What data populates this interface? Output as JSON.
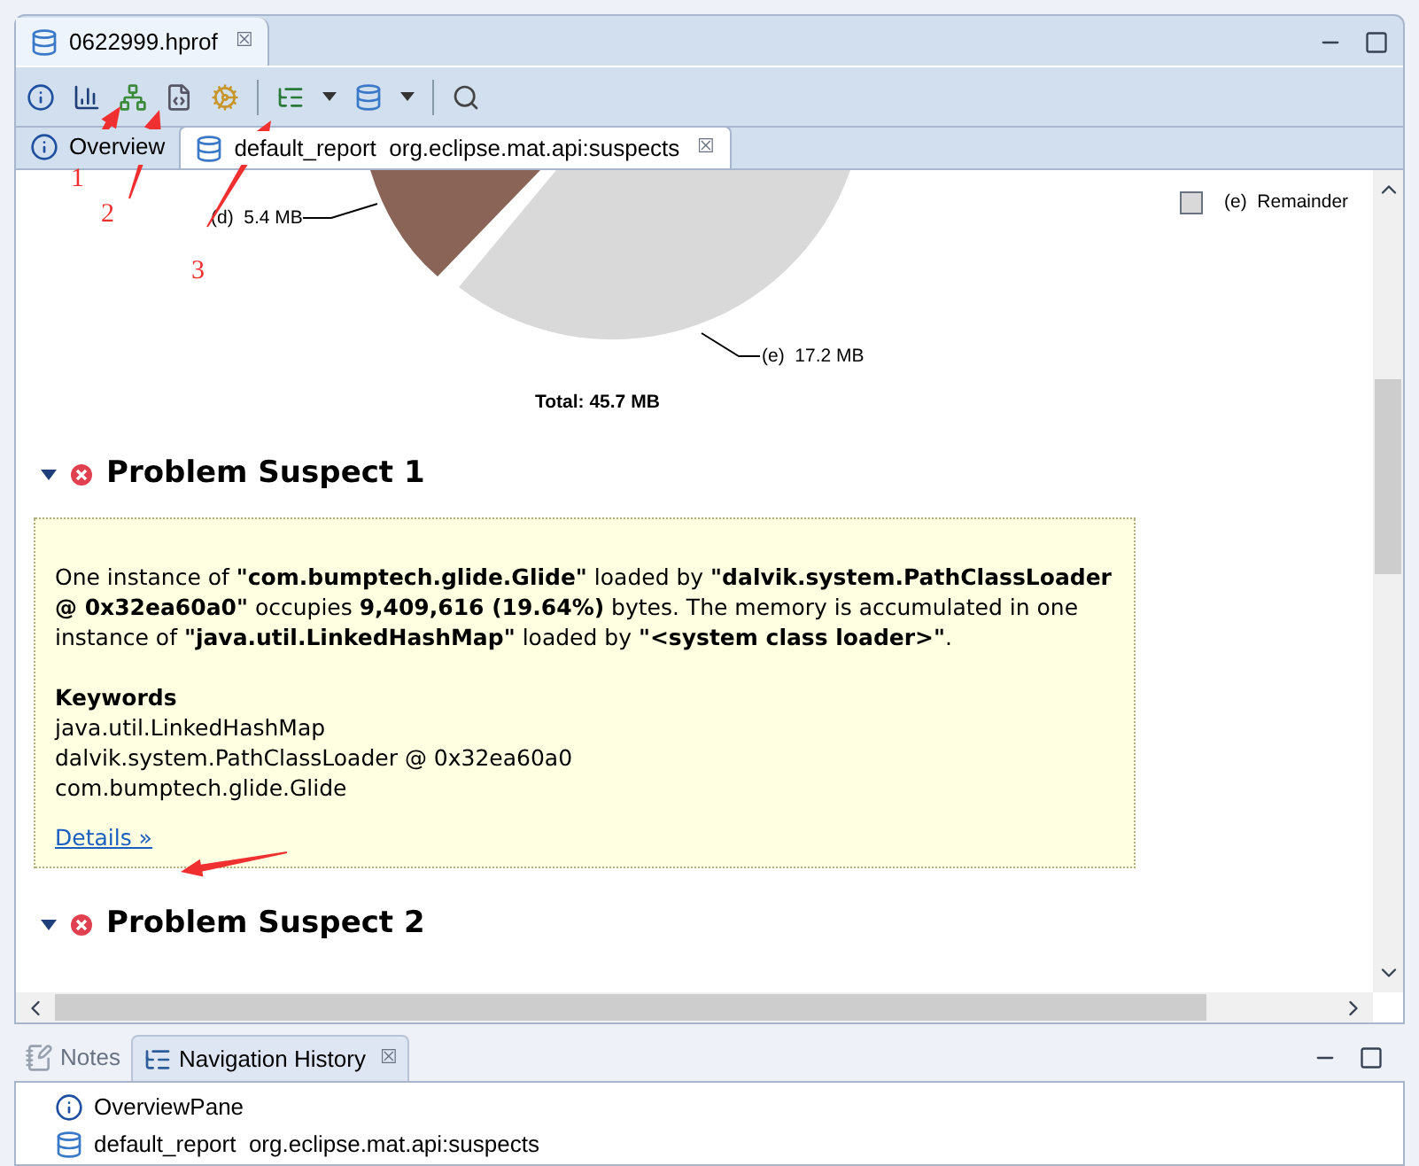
{
  "editor_tab": {
    "title": "0622999.hprof",
    "close": "☒"
  },
  "inner_tabs": [
    {
      "label": "Overview",
      "selected": false,
      "kind": "info"
    },
    {
      "label": "default_report  org.eclipse.mat.api:suspects",
      "selected": true,
      "kind": "report",
      "close": "☒"
    }
  ],
  "chart": {
    "labels": [
      {
        "text": "(d)  5.4 MB",
        "kind": "left"
      },
      {
        "text": "(e)  17.2 MB",
        "kind": "right"
      }
    ],
    "total": "Total: 45.7 MB",
    "legend": [
      {
        "label": "(e)  Remainder",
        "color": "#d9d9d9"
      }
    ]
  },
  "suspects": [
    {
      "title": "Problem Suspect 1",
      "description": "One instance of **\"com.bumptech.glide.Glide\"** loaded by **\"dalvik.system.PathClassLoader @ 0x32ea60a0\"** occupies **9,409,616 (19.64%)** bytes. The memory is accumulated in one instance of **\"java.util.LinkedHashMap\"** loaded by **\"<system class loader>\"**.",
      "keywords_heading": "Keywords",
      "keywords": [
        "java.util.LinkedHashMap",
        "dalvik.system.PathClassLoader @ 0x32ea60a0",
        "com.bumptech.glide.Glide"
      ],
      "link": "Details »"
    },
    {
      "title": "Problem Suspect 2"
    }
  ],
  "bottom_tabs": [
    {
      "label": "Notes",
      "selected": false,
      "kind": "notes"
    },
    {
      "label": "Navigation History",
      "selected": true,
      "kind": "history",
      "close": "☒"
    }
  ],
  "history": [
    {
      "label": "OverviewPane",
      "kind": "info"
    },
    {
      "label": "default_report  org.eclipse.mat.api:suspects",
      "kind": "report"
    }
  ],
  "annotations": [
    {
      "label": "1"
    },
    {
      "label": "2"
    },
    {
      "label": "3"
    }
  ]
}
